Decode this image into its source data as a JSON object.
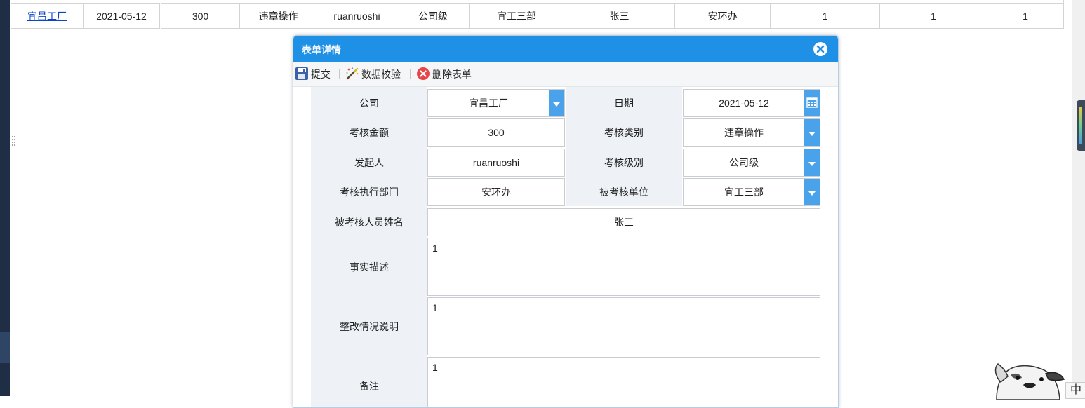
{
  "background_row": {
    "company_link": "宜昌工厂",
    "date": "2021-05-12",
    "amount": "300",
    "assessment_type": "违章操作",
    "initiator": "ruanruoshi",
    "assessment_level": "公司级",
    "assessed_unit": "宜工三部",
    "person_name": "张三",
    "exec_dept": "安环办",
    "col10": "1",
    "col11": "1",
    "col12": "1"
  },
  "modal": {
    "title": "表单详情",
    "toolbar": {
      "submit_label": "提交",
      "validate_label": "数据校验",
      "delete_label": "删除表单"
    },
    "form": {
      "company_label": "公司",
      "company_value": "宜昌工厂",
      "date_label": "日期",
      "date_value": "2021-05-12",
      "amount_label": "考核金额",
      "amount_value": "300",
      "type_label": "考核类别",
      "type_value": "违章操作",
      "initiator_label": "发起人",
      "initiator_value": "ruanruoshi",
      "level_label": "考核级别",
      "level_value": "公司级",
      "exec_dept_label": "考核执行部门",
      "exec_dept_value": "安环办",
      "unit_label": "被考核单位",
      "unit_value": "宜工三部",
      "person_label": "被考核人员姓名",
      "person_value": "张三",
      "fact_label": "事实描述",
      "fact_value": "1",
      "rectify_label": "整改情况说明",
      "rectify_value": "1",
      "remark_label": "备注",
      "remark_value": "1"
    }
  },
  "ime_indicator": "中",
  "colors": {
    "header_blue": "#1e90e6",
    "dropdown_blue": "#4aa3ea",
    "label_bg": "#eef2f6",
    "link": "#0b44c4"
  }
}
